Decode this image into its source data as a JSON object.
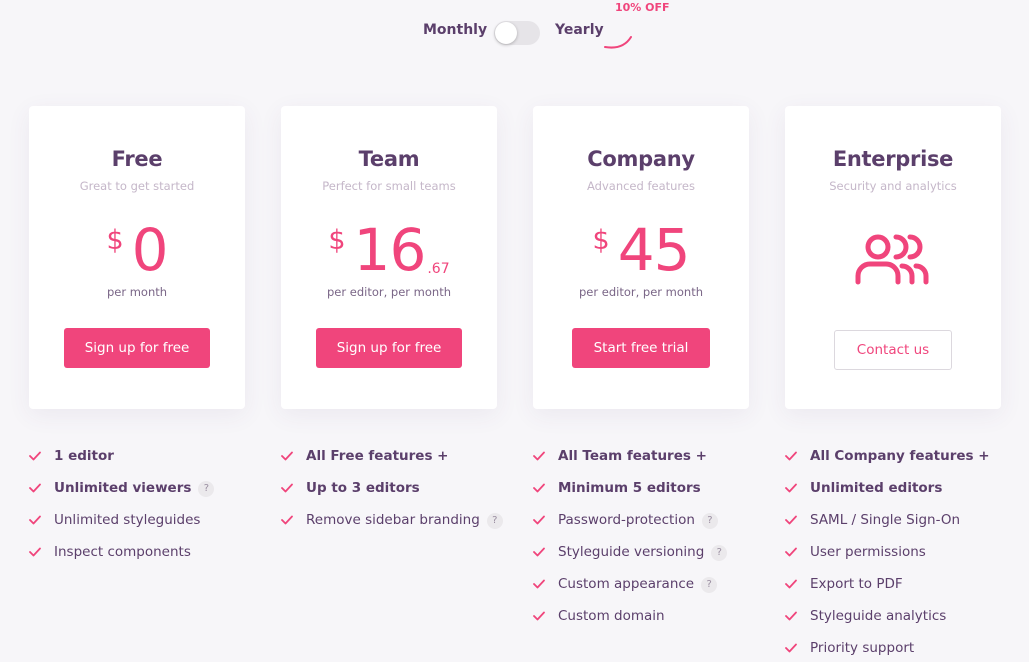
{
  "billing_toggle": {
    "monthly_label": "Monthly",
    "yearly_label": "Yearly",
    "selected": "Monthly",
    "discount_label": "10% OFF"
  },
  "colors": {
    "accent": "#f0457c",
    "heading": "#5b3f6b",
    "background": "#f7f6f9"
  },
  "plans": [
    {
      "name": "Free",
      "tagline": "Great to get started",
      "currency": "$",
      "amount": "0",
      "cents": "",
      "period": "per month",
      "cta": "Sign up for free",
      "features": [
        {
          "text": "1 editor",
          "bold": true,
          "help": false
        },
        {
          "text": "Unlimited viewers",
          "bold": true,
          "help": true
        },
        {
          "text": "Unlimited styleguides",
          "bold": false,
          "help": false
        },
        {
          "text": "Inspect components",
          "bold": false,
          "help": false
        }
      ]
    },
    {
      "name": "Team",
      "tagline": "Perfect for small teams",
      "currency": "$",
      "amount": "16",
      "cents": ".67",
      "period": "per editor, per month",
      "cta": "Sign up for free",
      "features": [
        {
          "text": "All Free features +",
          "bold": true,
          "help": false
        },
        {
          "text": "Up to 3 editors",
          "bold": true,
          "help": false
        },
        {
          "text": "Remove sidebar branding",
          "bold": false,
          "help": true
        }
      ]
    },
    {
      "name": "Company",
      "tagline": "Advanced features",
      "currency": "$",
      "amount": "45",
      "cents": "",
      "period": "per editor, per month",
      "cta": "Start free trial",
      "features": [
        {
          "text": "All Team features +",
          "bold": true,
          "help": false
        },
        {
          "text": "Minimum 5 editors",
          "bold": true,
          "help": false
        },
        {
          "text": "Password-protection",
          "bold": false,
          "help": true
        },
        {
          "text": "Styleguide versioning",
          "bold": false,
          "help": true
        },
        {
          "text": "Custom appearance",
          "bold": false,
          "help": true
        },
        {
          "text": "Custom domain",
          "bold": false,
          "help": false
        }
      ]
    },
    {
      "name": "Enterprise",
      "tagline": "Security and analytics",
      "icon": "users-icon",
      "cta": "Contact us",
      "features": [
        {
          "text": "All Company features +",
          "bold": true,
          "help": false
        },
        {
          "text": "Unlimited editors",
          "bold": true,
          "help": false
        },
        {
          "text": "SAML / Single Sign-On",
          "bold": false,
          "help": false
        },
        {
          "text": "User permissions",
          "bold": false,
          "help": false
        },
        {
          "text": "Export to PDF",
          "bold": false,
          "help": false
        },
        {
          "text": "Styleguide analytics",
          "bold": false,
          "help": false
        },
        {
          "text": "Priority support",
          "bold": false,
          "help": false
        }
      ]
    }
  ],
  "help_glyph": "?"
}
